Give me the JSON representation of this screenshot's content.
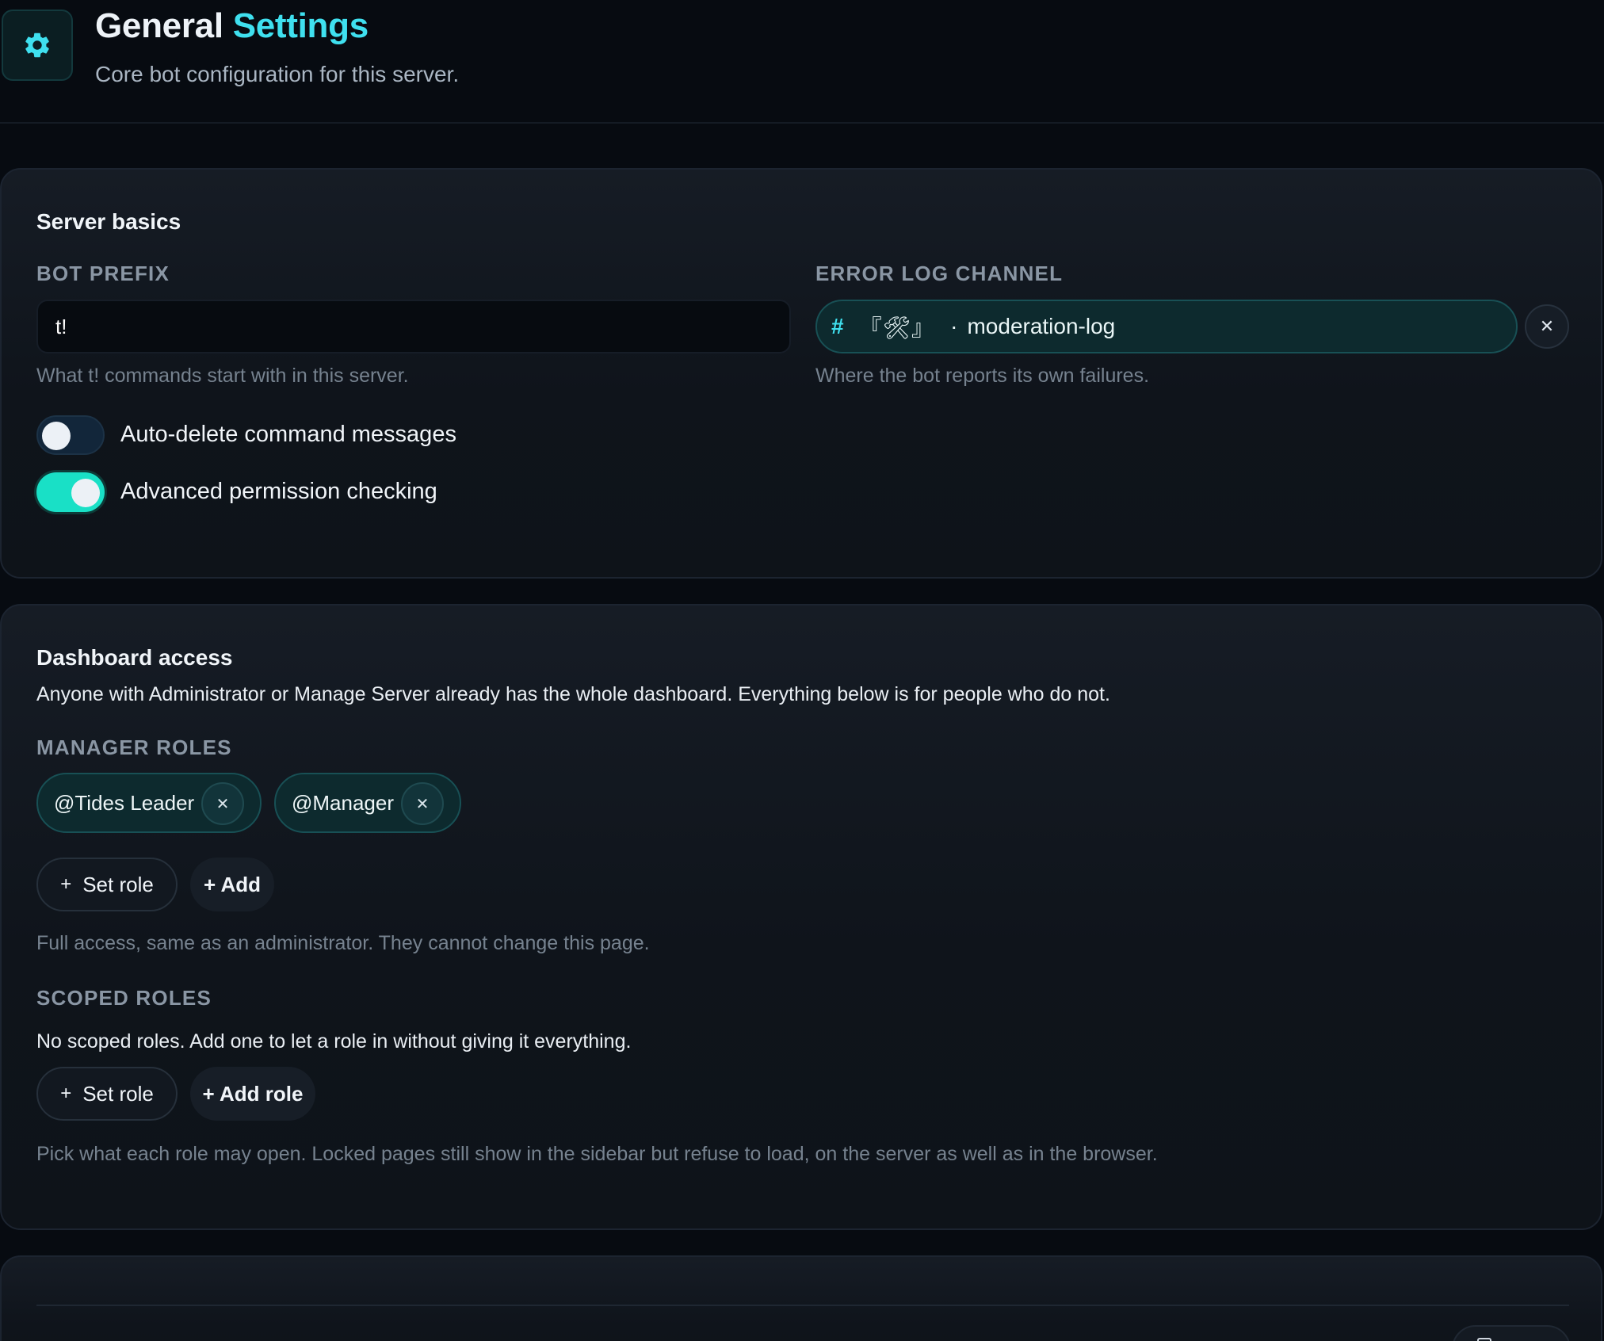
{
  "header": {
    "title_main": "General",
    "title_accent": "Settings",
    "subtitle": "Core bot configuration for this server.",
    "icon": "gear-icon"
  },
  "server_basics": {
    "title": "Server basics",
    "bot_prefix": {
      "label": "BOT PREFIX",
      "value": "t!",
      "help": "What t! commands start with in this server."
    },
    "error_log": {
      "label": "ERROR LOG CHANNEL",
      "hash": "#",
      "decoration": "『🛠』",
      "separator": "·",
      "channel": "moderation-log",
      "clear_symbol": "✕",
      "help": "Where the bot reports its own failures."
    },
    "toggles": [
      {
        "label": "Auto-delete command messages",
        "on": false
      },
      {
        "label": "Advanced permission checking",
        "on": true
      }
    ]
  },
  "dashboard_access": {
    "title": "Dashboard access",
    "description": "Anyone with Administrator or Manage Server already has the whole dashboard. Everything below is for people who do not.",
    "manager_roles": {
      "label": "MANAGER ROLES",
      "roles": [
        "@Tides Leader",
        "@Manager"
      ],
      "remove_symbol": "✕",
      "set_role": "Set role",
      "add": "+ Add",
      "help": "Full access, same as an administrator. They cannot change this page."
    },
    "scoped_roles": {
      "label": "SCOPED ROLES",
      "empty": "No scoped roles. Add one to let a role in without giving it everything.",
      "set_role": "Set role",
      "add_role": "+ Add role",
      "help": "Pick what each role may open. Locked pages still show in the sidebar but refuse to load, on the server as well as in the browser."
    },
    "plus_symbol": "+"
  },
  "colors": {
    "accent": "#3fe0ef",
    "toggle_on": "#19e0c6",
    "background": "#070b11"
  }
}
